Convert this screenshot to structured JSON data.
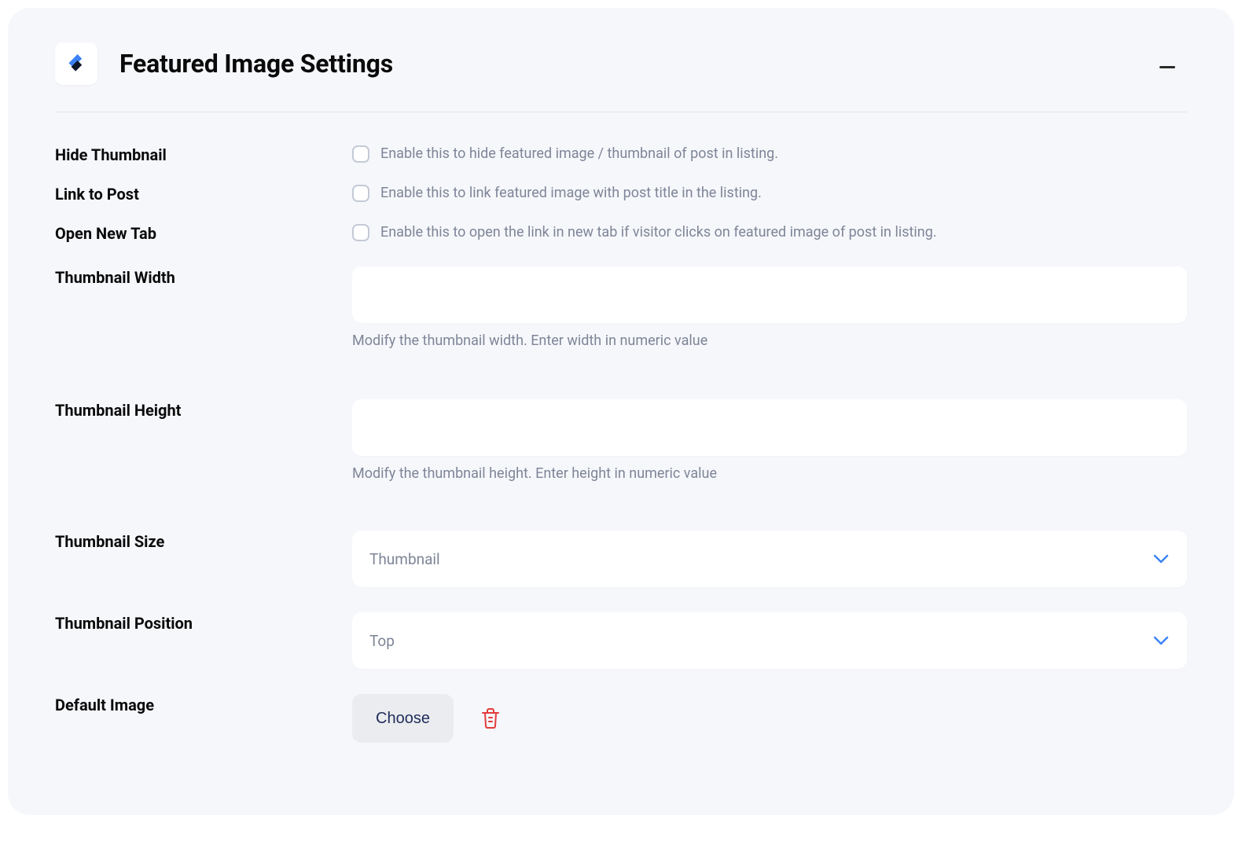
{
  "panel": {
    "title": "Featured Image Settings"
  },
  "fields": {
    "hideThumbnail": {
      "label": "Hide Thumbnail",
      "help": "Enable this to hide featured image / thumbnail of post in listing."
    },
    "linkToPost": {
      "label": "Link to Post",
      "help": "Enable this to link featured image with post title in the listing."
    },
    "openNewTab": {
      "label": "Open New Tab",
      "help": "Enable this to open the link in new tab if visitor clicks on featured image of post in listing."
    },
    "thumbnailWidth": {
      "label": "Thumbnail Width",
      "value": "",
      "help": "Modify the thumbnail width. Enter width in numeric value"
    },
    "thumbnailHeight": {
      "label": "Thumbnail Height",
      "value": "",
      "help": "Modify the thumbnail height. Enter height in numeric value"
    },
    "thumbnailSize": {
      "label": "Thumbnail Size",
      "value": "Thumbnail"
    },
    "thumbnailPosition": {
      "label": "Thumbnail Position",
      "value": "Top"
    },
    "defaultImage": {
      "label": "Default Image",
      "chooseLabel": "Choose"
    }
  }
}
